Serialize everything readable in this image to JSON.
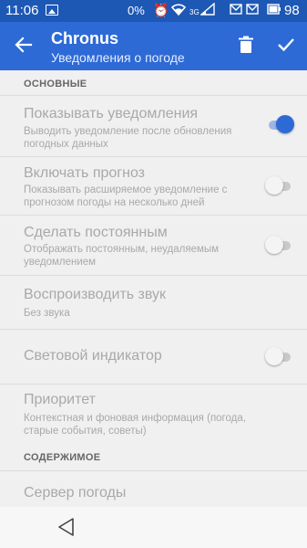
{
  "status_bar": {
    "time": "11:06",
    "battery_percent_text": "0%",
    "signal_text": "3G",
    "battery_level": "98",
    "icons": [
      "image-icon",
      "alarm-icon",
      "wifi-icon",
      "signal-icon",
      "mail-icon",
      "battery-icon"
    ]
  },
  "app_bar": {
    "title": "Chronus",
    "subtitle": "Уведомления о погоде",
    "accent_color": "#2d6ad6"
  },
  "sections": [
    {
      "header": "ОСНОВНЫЕ"
    },
    {
      "header": "СОДЕРЖИМОЕ"
    }
  ],
  "preferences": [
    {
      "title": "Показывать уведомления",
      "summary": "Выводить уведомление после обновления погодных данных",
      "switch_on": true
    },
    {
      "title": "Включать прогноз",
      "summary": "Показывать расширяемое уведомление с прогнозом погоды на несколько дней",
      "switch_on": false
    },
    {
      "title": "Сделать постоянным",
      "summary": "Отображать постоянным, неудаляемым уведомлением",
      "switch_on": false
    },
    {
      "title": "Воспроизводить звук",
      "summary": "Без звука"
    },
    {
      "title": "Световой индикатор",
      "switch_on": false
    },
    {
      "title": "Приоритет",
      "summary": "Контекстная и фоновая информация (погода, старые события, советы)"
    },
    {
      "title": "Сервер погоды"
    }
  ]
}
